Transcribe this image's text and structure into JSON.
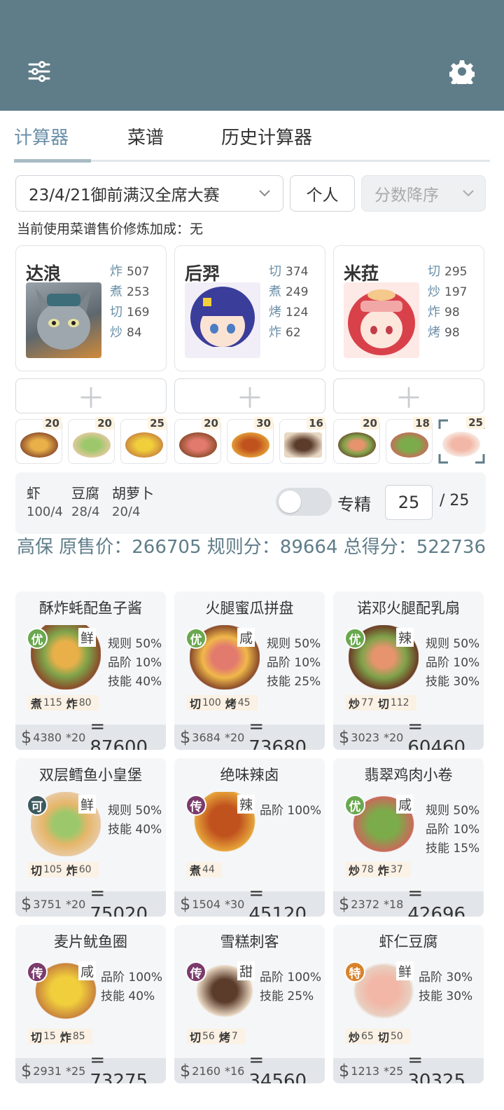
{
  "tabs": [
    "计算器",
    "菜谱",
    "历史计算器"
  ],
  "contest": "23/4/21御前满汉全席大赛",
  "mode": "个人",
  "sort": "分数降序",
  "note": "当前使用菜谱售价修炼加成：无",
  "chefs": [
    {
      "name": "达浪",
      "skills": [
        [
          "炸",
          "507"
        ],
        [
          "煮",
          "253"
        ],
        [
          "切",
          "169"
        ],
        [
          "炒",
          "84"
        ]
      ]
    },
    {
      "name": "后羿",
      "skills": [
        [
          "切",
          "374"
        ],
        [
          "煮",
          "249"
        ],
        [
          "烤",
          "124"
        ],
        [
          "炸",
          "62"
        ]
      ]
    },
    {
      "name": "米菈",
      "skills": [
        [
          "切",
          "295"
        ],
        [
          "炒",
          "197"
        ],
        [
          "炸",
          "98"
        ],
        [
          "烤",
          "98"
        ]
      ]
    }
  ],
  "plus": "＋",
  "dish_counts": [
    "20",
    "20",
    "25",
    "20",
    "30",
    "16",
    "20",
    "18",
    "25"
  ],
  "ingredients": [
    {
      "name": "虾",
      "qty": "100/4"
    },
    {
      "name": "豆腐",
      "qty": "28/4"
    },
    {
      "name": "胡萝卜",
      "qty": "20/4"
    }
  ],
  "specialize_label": "专精",
  "specialize_value": "25",
  "specialize_max": "/ 25",
  "summary_line": "高保 原售价：266705 规则分：89664 总得分：522736",
  "recipes": [
    {
      "title": "酥炸蚝配鱼子酱",
      "rank": "优",
      "flavor": "鲜",
      "rules": [
        "规则 50%",
        "品阶 10%",
        "技能 40%"
      ],
      "skills": [
        [
          "煮",
          "115"
        ],
        [
          "炸",
          "80"
        ]
      ],
      "price": "4380",
      "mult": "*20",
      "total": "= 87600"
    },
    {
      "title": "火腿蜜瓜拼盘",
      "rank": "优",
      "flavor": "咸",
      "rules": [
        "规则 50%",
        "品阶 10%",
        "技能 25%"
      ],
      "skills": [
        [
          "切",
          "100"
        ],
        [
          "烤",
          "45"
        ]
      ],
      "price": "3684",
      "mult": "*20",
      "total": "= 73680"
    },
    {
      "title": "诺邓火腿配乳扇",
      "rank": "优",
      "flavor": "辣",
      "rules": [
        "规则 50%",
        "品阶 10%",
        "技能 30%"
      ],
      "skills": [
        [
          "炒",
          "77"
        ],
        [
          "切",
          "112"
        ]
      ],
      "price": "3023",
      "mult": "*20",
      "total": "= 60460"
    },
    {
      "title": "双层鳕鱼小皇堡",
      "rank": "可",
      "flavor": "鲜",
      "rules": [
        "规则 50%",
        "技能 40%"
      ],
      "skills": [
        [
          "切",
          "105"
        ],
        [
          "炸",
          "60"
        ]
      ],
      "price": "3751",
      "mult": "*20",
      "total": "= 75020"
    },
    {
      "title": "绝味辣卤",
      "rank": "传",
      "flavor": "辣",
      "rules": [
        "品阶 100%"
      ],
      "skills": [
        [
          "煮",
          "44"
        ]
      ],
      "price": "1504",
      "mult": "*30",
      "total": "= 45120"
    },
    {
      "title": "翡翠鸡肉小卷",
      "rank": "优",
      "flavor": "咸",
      "rules": [
        "规则 50%",
        "品阶 10%",
        "技能 15%"
      ],
      "skills": [
        [
          "炒",
          "78"
        ],
        [
          "炸",
          "37"
        ]
      ],
      "price": "2372",
      "mult": "*18",
      "total": "= 42696"
    },
    {
      "title": "麦片鱿鱼圈",
      "rank": "传",
      "flavor": "咸",
      "rules": [
        "品阶 100%",
        "技能 40%"
      ],
      "skills": [
        [
          "切",
          "15"
        ],
        [
          "炸",
          "85"
        ]
      ],
      "price": "2931",
      "mult": "*25",
      "total": "= 73275"
    },
    {
      "title": "雪糕刺客",
      "rank": "传",
      "flavor": "甜",
      "rules": [
        "品阶 100%",
        "技能 25%"
      ],
      "skills": [
        [
          "切",
          "56"
        ],
        [
          "烤",
          "7"
        ]
      ],
      "price": "2160",
      "mult": "*16",
      "total": "= 34560"
    },
    {
      "title": "虾仁豆腐",
      "rank": "特",
      "flavor": "鲜",
      "rules": [
        "品阶 30%",
        "技能 30%"
      ],
      "skills": [
        [
          "炒",
          "65"
        ],
        [
          "切",
          "50"
        ]
      ],
      "price": "1213",
      "mult": "*25",
      "total": "= 30325"
    }
  ],
  "colors": {
    "header": "#5f7d89",
    "rank_you": "#6aa84f",
    "rank_ke": "#3d5a5e",
    "rank_chuan": "#7b3b6b",
    "rank_te": "#d9822b"
  }
}
